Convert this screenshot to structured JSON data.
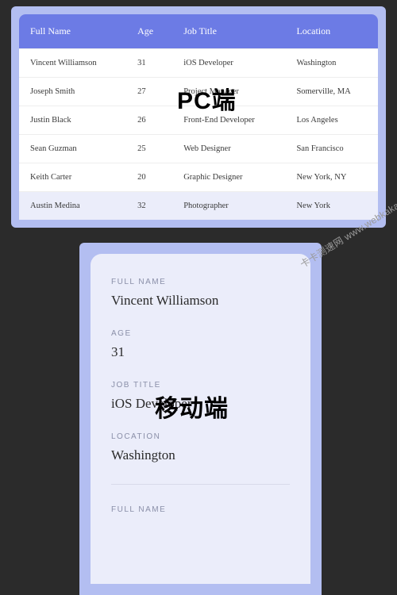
{
  "labels": {
    "pc": "PC端",
    "mobile": "移动端"
  },
  "watermark": "卡卡测速网 www.webkaka.com",
  "table": {
    "headers": [
      "Full Name",
      "Age",
      "Job Title",
      "Location"
    ],
    "header_keys": [
      "full_name",
      "age",
      "job_title",
      "location"
    ],
    "rows": [
      {
        "full_name": "Vincent Williamson",
        "age": "31",
        "job_title": "iOS Developer",
        "location": "Washington"
      },
      {
        "full_name": "Joseph Smith",
        "age": "27",
        "job_title": "Project Manager",
        "location": "Somerville, MA"
      },
      {
        "full_name": "Justin Black",
        "age": "26",
        "job_title": "Front-End Developer",
        "location": "Los Angeles"
      },
      {
        "full_name": "Sean Guzman",
        "age": "25",
        "job_title": "Web Designer",
        "location": "San Francisco"
      },
      {
        "full_name": "Keith Carter",
        "age": "20",
        "job_title": "Graphic Designer",
        "location": "New York, NY"
      },
      {
        "full_name": "Austin Medina",
        "age": "32",
        "job_title": "Photographer",
        "location": "New York"
      }
    ]
  },
  "mobile": {
    "fields": [
      {
        "label": "FULL NAME",
        "value": "Vincent Williamson"
      },
      {
        "label": "AGE",
        "value": "31"
      },
      {
        "label": "JOB TITLE",
        "value": "iOS Developer"
      },
      {
        "label": "LOCATION",
        "value": "Washington"
      }
    ],
    "next_label": "FULL NAME"
  }
}
